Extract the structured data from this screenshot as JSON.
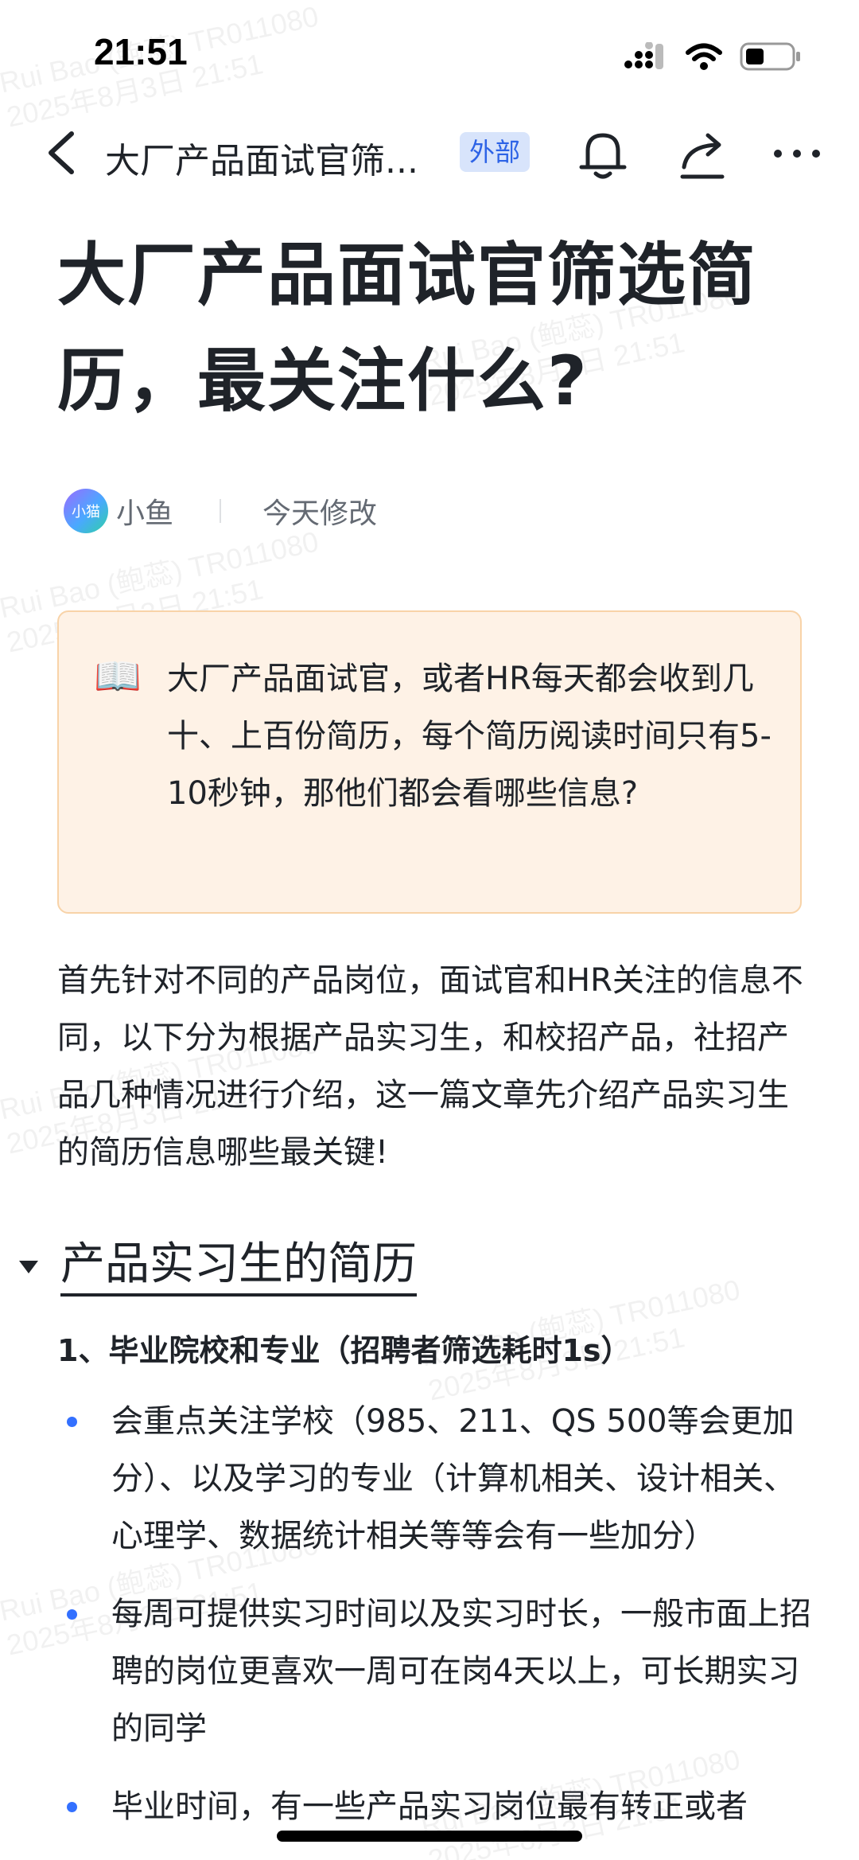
{
  "status_bar": {
    "time": "21:51"
  },
  "nav": {
    "title": "大厂产品面试官筛...",
    "badge": "外部"
  },
  "doc": {
    "title": "大厂产品面试官筛选简历，最关注什么?",
    "author_avatar_text": "小猫",
    "author_name": "小鱼",
    "modified": "今天修改",
    "callout_icon": "📖",
    "callout_text": "大厂产品面试官，或者HR每天都会收到几十、上百份简历，每个简历阅读时间只有5-10秒钟，那他们都会看哪些信息?",
    "intro_paragraph": "首先针对不同的产品岗位，面试官和HR关注的信息不同，以下分为根据产品实习生，和校招产品，社招产品几种情况进行介绍，这一篇文章先介绍产品实习生的简历信息哪些最关键!",
    "section_heading": "产品实习生的简历",
    "subheading": "1、毕业院校和专业（招聘者筛选耗时1s）",
    "bullets": [
      "会重点关注学校（985、211、QS 500等会更加分）、以及学习的专业（计算机相关、设计相关、心理学、数据统计相关等等会有一些加分）",
      "每周可提供实习时间以及实习时长，一般市面上招聘的岗位更喜欢一周可在岗4天以上，可长期实习的同学",
      "毕业时间，有一些产品实习岗位最有转正或者"
    ]
  },
  "watermark": {
    "line1": "Rui Bao (鲍蕊) TR011080",
    "line2": "2025年8月3日 21:51"
  },
  "colors": {
    "accent": "#3370ff",
    "callout_bg": "#fef2e6",
    "callout_border": "#f8d3a8",
    "badge_bg": "#d8e4fb",
    "badge_text": "#2d63e6"
  }
}
